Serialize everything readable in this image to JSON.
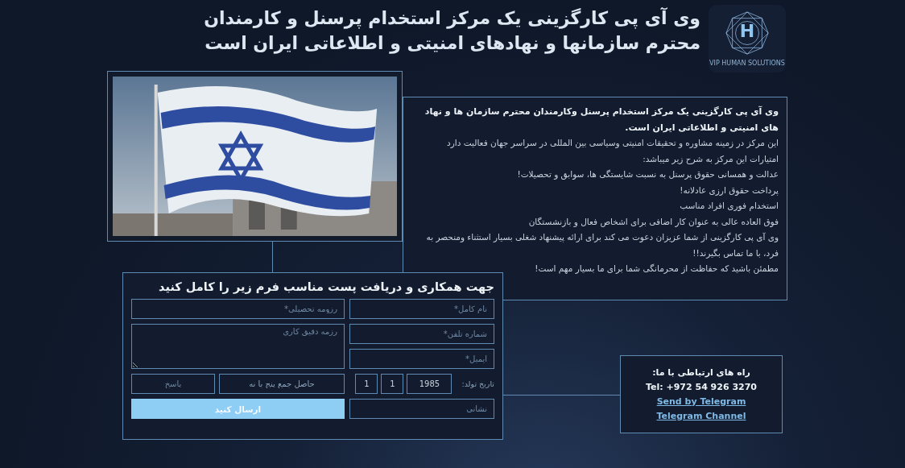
{
  "header": {
    "title_lines": [
      "وی آی پی کارگزینی یک مرکز استخدام پرسنل و کارمندان",
      "محترم سازمانها و نهادهای امنیتی و اطلاعاتی ایران است"
    ],
    "logo_mark": "H",
    "logo_caption": "VIP HUMAN SOLUTIONS"
  },
  "intro": {
    "lead": "وی آی پی کارگزینی یک مرکز استخدام پرسنل وکارمندان محترم سازمان ها و نهاد های امنیتی و اطلاعاتی ایران است.",
    "lines": [
      "این مرکز در زمینه مشاوره و تحقیقات امنیتی وسیاسی بین المللی در سراسر جهان فعالیت دارد",
      "امتیارات این مرکز به شرح زیر میباشد:",
      "عدالت و همسانی حقوق پرسنل به نسبت شایستگی ها، سوابق و تحصیلات!",
      "پرداخت حقوق ارزی عادلانه!",
      "استخدام فوری افراد مناسب",
      "فوق العاده عالی به عنوان کار اضافی برای اشخاص فعال و بازنشستگان",
      "وی آی پی کارگزینی از شما عزیزان دعوت می کند برای ارائه پیشنهاد شغلی بسیار استثناء ومنحصر به فرد، با ما تماس بگیرند!!",
      "مطمئن باشید که حفاظت از محرمانگی شما برای ما بسیار مهم است!"
    ]
  },
  "form": {
    "title": "جهت همکاری و دریافت پست مناسب فرم زیر را کامل کنید",
    "full_name": {
      "placeholder": "نام کامل*"
    },
    "education": {
      "placeholder": "رزومه تحصیلی*"
    },
    "phone": {
      "placeholder": "شماره تلفن*"
    },
    "work_summary": {
      "placeholder": "رزمه دقیق کاری"
    },
    "email": {
      "placeholder": "ایمیل*"
    },
    "birth_date": {
      "label": "تاریخ تولد:",
      "year": "1985",
      "month": "1",
      "day": "1"
    },
    "captcha": {
      "question": "حاصل جمع پنج با نه",
      "answer_placeholder": "پاسخ"
    },
    "address": {
      "placeholder": "نشانی"
    },
    "submit": "ارسال کنید"
  },
  "contact": {
    "heading": "راه های ارتباطی با ما:",
    "phone": "Tel: +972 54 926 3270",
    "links": [
      "Send by Telegram",
      "Telegram Channel"
    ]
  }
}
